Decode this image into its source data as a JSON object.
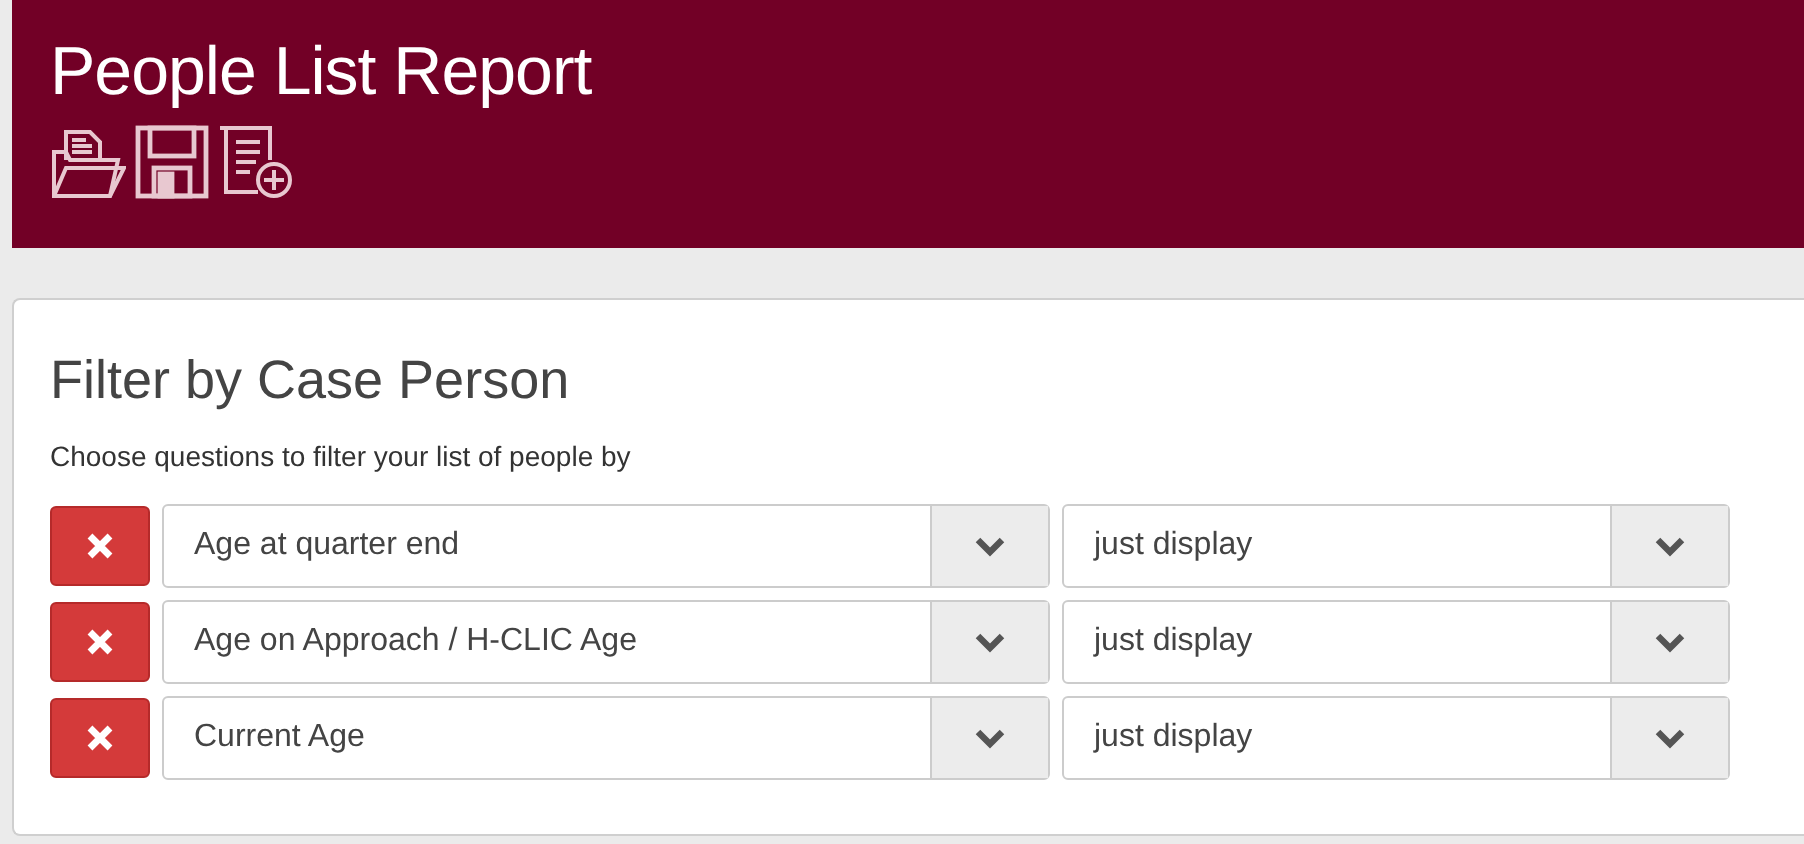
{
  "header": {
    "title": "People List Report"
  },
  "filter": {
    "title": "Filter by Case Person",
    "description": "Choose questions to filter your list of people by",
    "rows": [
      {
        "question": "Age at quarter end",
        "operator": "just display"
      },
      {
        "question": "Age on Approach / H-CLIC Age",
        "operator": "just display"
      },
      {
        "question": "Current Age",
        "operator": "just display"
      }
    ]
  }
}
